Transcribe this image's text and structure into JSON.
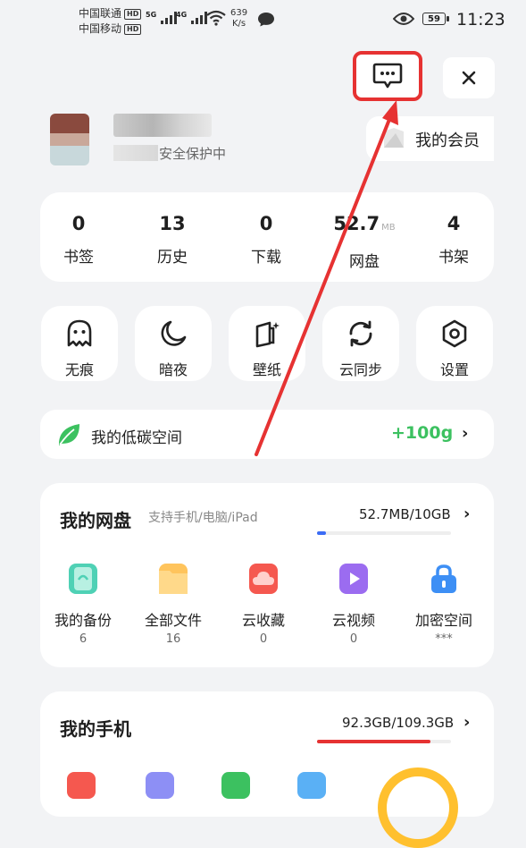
{
  "status_bar": {
    "carrier1": "中国联通",
    "carrier2": "中国移动",
    "net1": "5G",
    "net2": "4G",
    "speed_value": "639",
    "speed_unit": "K/s",
    "battery": "59",
    "time": "11:23",
    "hd": "HD"
  },
  "header": {
    "security_text": "安全保护中",
    "member_label": "我的会员"
  },
  "stats": [
    {
      "value": "0",
      "label": "书签"
    },
    {
      "value": "13",
      "label": "历史"
    },
    {
      "value": "0",
      "label": "下载"
    },
    {
      "value": "52.7",
      "unit": "MB",
      "label": "网盘"
    },
    {
      "value": "4",
      "label": "书架"
    }
  ],
  "shortcuts": [
    {
      "label": "无痕",
      "icon": "ghost-icon"
    },
    {
      "label": "暗夜",
      "icon": "moon-icon"
    },
    {
      "label": "壁纸",
      "icon": "wallpaper-icon"
    },
    {
      "label": "云同步",
      "icon": "sync-icon"
    },
    {
      "label": "设置",
      "icon": "settings-icon"
    }
  ],
  "carbon": {
    "label": "我的低碳空间",
    "value": "+100g"
  },
  "cloud_disk": {
    "title": "我的网盘",
    "subtitle": "支持手机/电脑/iPad",
    "usage": "52.7MB/10GB",
    "usage_fraction": 0.005,
    "items": [
      {
        "label": "我的备份",
        "count": "6",
        "color": "#4fd1b5"
      },
      {
        "label": "全部文件",
        "count": "16",
        "color": "#ffc45c"
      },
      {
        "label": "云收藏",
        "count": "0",
        "color": "#f5584f"
      },
      {
        "label": "云视频",
        "count": "0",
        "color": "#9b6cf0"
      },
      {
        "label": "加密空间",
        "count": "***",
        "color": "#3d8ff5"
      }
    ]
  },
  "phone": {
    "title": "我的手机",
    "usage": "92.3GB/109.3GB",
    "usage_fraction": 0.844
  },
  "colors": {
    "accent_red": "#e63232",
    "green": "#3cc160",
    "progress_blue": "#3b6cf5"
  }
}
